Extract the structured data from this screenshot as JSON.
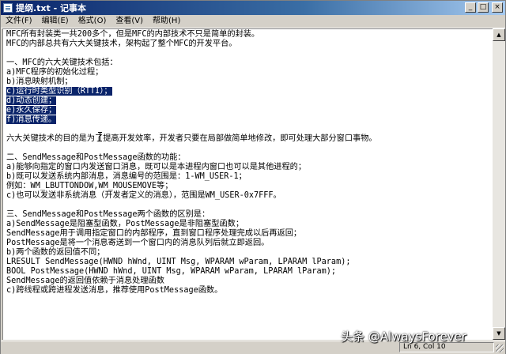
{
  "window": {
    "title": "提纲.txt - 记事本"
  },
  "title_buttons": {
    "minimize": "_",
    "maximize": "□",
    "close": "×"
  },
  "menu": [
    {
      "label": "文件(F)"
    },
    {
      "label": "编辑(E)"
    },
    {
      "label": "格式(O)"
    },
    {
      "label": "查看(V)"
    },
    {
      "label": "帮助(H)"
    }
  ],
  "document": {
    "lines": [
      "MFC所有封装类一共200多个，但是MFC的内部技术不只是简单的封装。",
      "MFC的内部总共有六大关键技术，架构起了整个MFC的开发平台。",
      "",
      "一、MFC的六大关键技术包括：",
      "a)MFC程序的初始化过程；",
      "b)消息映射机制；",
      "c)运行时类型识别（RTTI）；",
      "d)动态创建；",
      "e)永久保存；",
      "f)消息传递。",
      "",
      "六大关键技术的目的是为了提高开发效率，开发者只要在局部做简单地修改，即可处理大部分窗口事物。",
      "",
      "二、SendMessage和PostMessage函数的功能：",
      "a)能够向指定的窗口内发送窗口消息，既可以是本进程内窗口也可以是其他进程的；",
      "b)既可以发送系统内部消息，消息编号的范围是：1-WM_USER-1；",
      "例如：WM_LBUTTONDOW,WM_MOUSEMOVE等；",
      "c)也可以发送非系统消息（开发者定义的消息），范围是WM_USER-0x7FFF。",
      "",
      "三、SendMessage和PostMessage两个函数的区别是：",
      "a)SendMessage是阻塞型函数，PostMessage是非阻塞型函数；",
      "SendMessage用于调用指定窗口的内部程序，直到窗口程序处理完成以后再返回；",
      "PostMessage是将一个消息寄送到一个窗口内的消息队列后就立即返回。",
      "b)两个函数的返回值不同；",
      "LRESULT SendMessage(HWND hWnd, UINT Msg, WPARAM wParam, LPARAM lParam);",
      "BOOL PostMessage(HWND hWnd, UINT Msg, WPARAM wParam, LPARAM lParam);",
      "SendMessage的返回值依赖于消息处理函数",
      "c)跨线程或跨进程发送消息，推荐使用PostMessage函数。"
    ],
    "selected_lines": [
      6,
      7,
      8,
      9
    ]
  },
  "scrollbar": {
    "up_arrow": "▲",
    "down_arrow": "▼"
  },
  "status": {
    "position": "Ln 6, Col 10"
  },
  "watermark": {
    "text": "头条 @AlwaysForever"
  }
}
